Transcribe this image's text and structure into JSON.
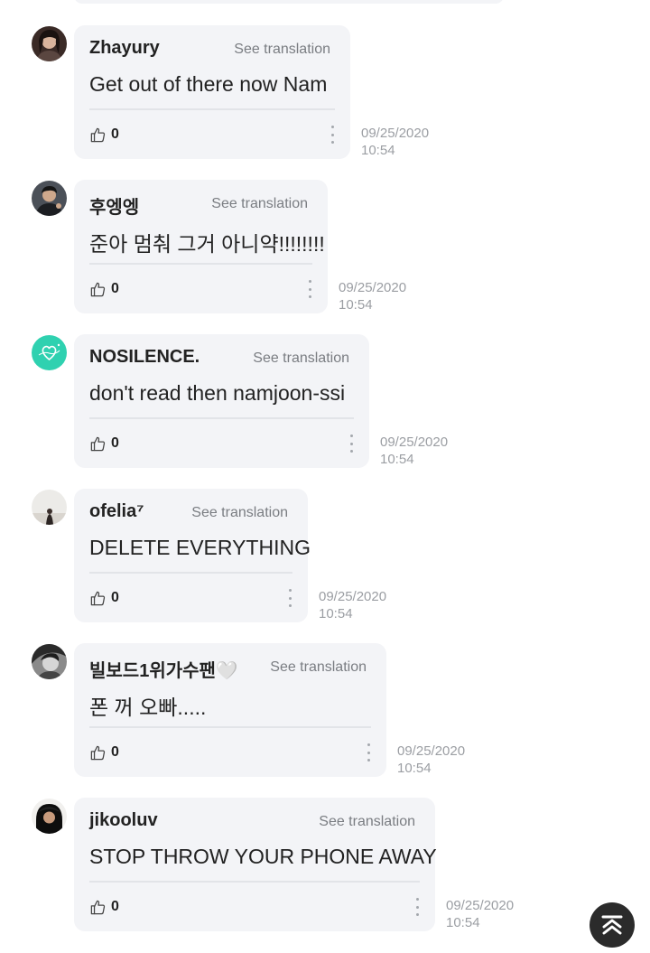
{
  "ui": {
    "see_translation": "See translation",
    "scroll_top_icon": "scroll-to-top-icon",
    "like_icon": "thumbs-up-icon",
    "more_icon": "more-vertical-icon"
  },
  "comments": [
    {
      "username": "Zhayury",
      "text": "Get out of there now Nam",
      "likes": "0",
      "date": "09/25/2020",
      "time": "10:54",
      "avatar": "avatar-dark-hair"
    },
    {
      "username": "후엥엥",
      "text": "준아 멈춰 그거 아니약!!!!!!!!",
      "likes": "0",
      "date": "09/25/2020",
      "time": "10:54",
      "avatar": "avatar-person-dark-jacket"
    },
    {
      "username": "NOSILENCE.",
      "text": "don't read then namjoon-ssi",
      "likes": "0",
      "date": "09/25/2020",
      "time": "10:54",
      "avatar": "avatar-teal-heart"
    },
    {
      "username": "ofelia⁷",
      "text": "DELETE EVERYTHING",
      "likes": "0",
      "date": "09/25/2020",
      "time": "10:54",
      "avatar": "avatar-light-figure"
    },
    {
      "username": "빌보드1위가수팬🤍",
      "text": "폰 꺼 오빠.....",
      "likes": "0",
      "date": "09/25/2020",
      "time": "10:54",
      "avatar": "avatar-grayscale-face"
    },
    {
      "username": "jikooluv",
      "text": "STOP THROW YOUR PHONE AWAY",
      "likes": "0",
      "date": "09/25/2020",
      "time": "10:54",
      "avatar": "avatar-black-hat"
    }
  ],
  "colors": {
    "bubble": "#f3f4f7",
    "meta_text": "#9b9ea3",
    "scroll_button": "#2b2b2b"
  }
}
